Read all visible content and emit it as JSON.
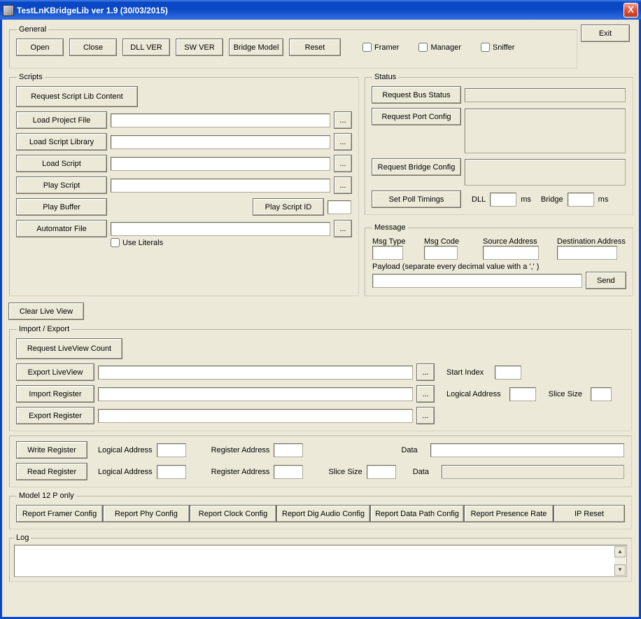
{
  "window": {
    "title": "TestLnKBridgeLib ver 1.9 (30/03/2015)"
  },
  "exit_label": "Exit",
  "general": {
    "legend": "General",
    "open": "Open",
    "close": "Close",
    "dll_ver": "DLL VER",
    "sw_ver": "SW VER",
    "bridge_model": "Bridge Model",
    "reset": "Reset",
    "framer": "Framer",
    "manager": "Manager",
    "sniffer": "Sniffer"
  },
  "scripts": {
    "legend": "Scripts",
    "request_script_lib": "Request Script Lib Content",
    "load_project_file": "Load Project File",
    "load_script_library": "Load Script Library",
    "load_script": "Load Script",
    "play_script": "Play Script",
    "play_buffer": "Play Buffer",
    "play_script_id": "Play Script ID",
    "automator_file": "Automator File",
    "use_literals": "Use Literals",
    "browse": "..."
  },
  "clear_live_view": "Clear Live View",
  "status": {
    "legend": "Status",
    "request_bus_status": "Request Bus Status",
    "request_port_config": "Request Port Config",
    "request_bridge_config": "Request Bridge Config",
    "set_poll_timings": "Set Poll Timings",
    "dll_label": "DLL",
    "ms1": "ms",
    "bridge_label": "Bridge",
    "ms2": "ms"
  },
  "message": {
    "legend": "Message",
    "msg_type": "Msg Type",
    "msg_code": "Msg Code",
    "source_address": "Source Address",
    "destination_address": "Destination Address",
    "payload_label": "Payload  (separate every decimal value with a ',' )",
    "send": "Send"
  },
  "import_export": {
    "legend": "Import / Export",
    "request_liveview_count": "Request LiveView Count",
    "export_liveview": "Export LiveView",
    "import_register": "Import Register",
    "export_register": "Export Register",
    "start_index": "Start Index",
    "logical_address": "Logical Address",
    "slice_size": "Slice Size",
    "browse": "..."
  },
  "register": {
    "write_register": "Write Register",
    "read_register": "Read Register",
    "logical_address": "Logical Address",
    "register_address": "Register Address",
    "slice_size": "Slice Size",
    "data": "Data"
  },
  "model12": {
    "legend": "Model 12 P only",
    "report_framer_config": "Report Framer Config",
    "report_phy_config": "Report Phy Config",
    "report_clock_config": "Report Clock Config",
    "report_dig_audio_config": "Report Dig Audio Config",
    "report_data_path_config": "Report Data Path Config",
    "report_presence_rate": "Report Presence Rate",
    "ip_reset": "IP Reset"
  },
  "log": {
    "legend": "Log"
  }
}
